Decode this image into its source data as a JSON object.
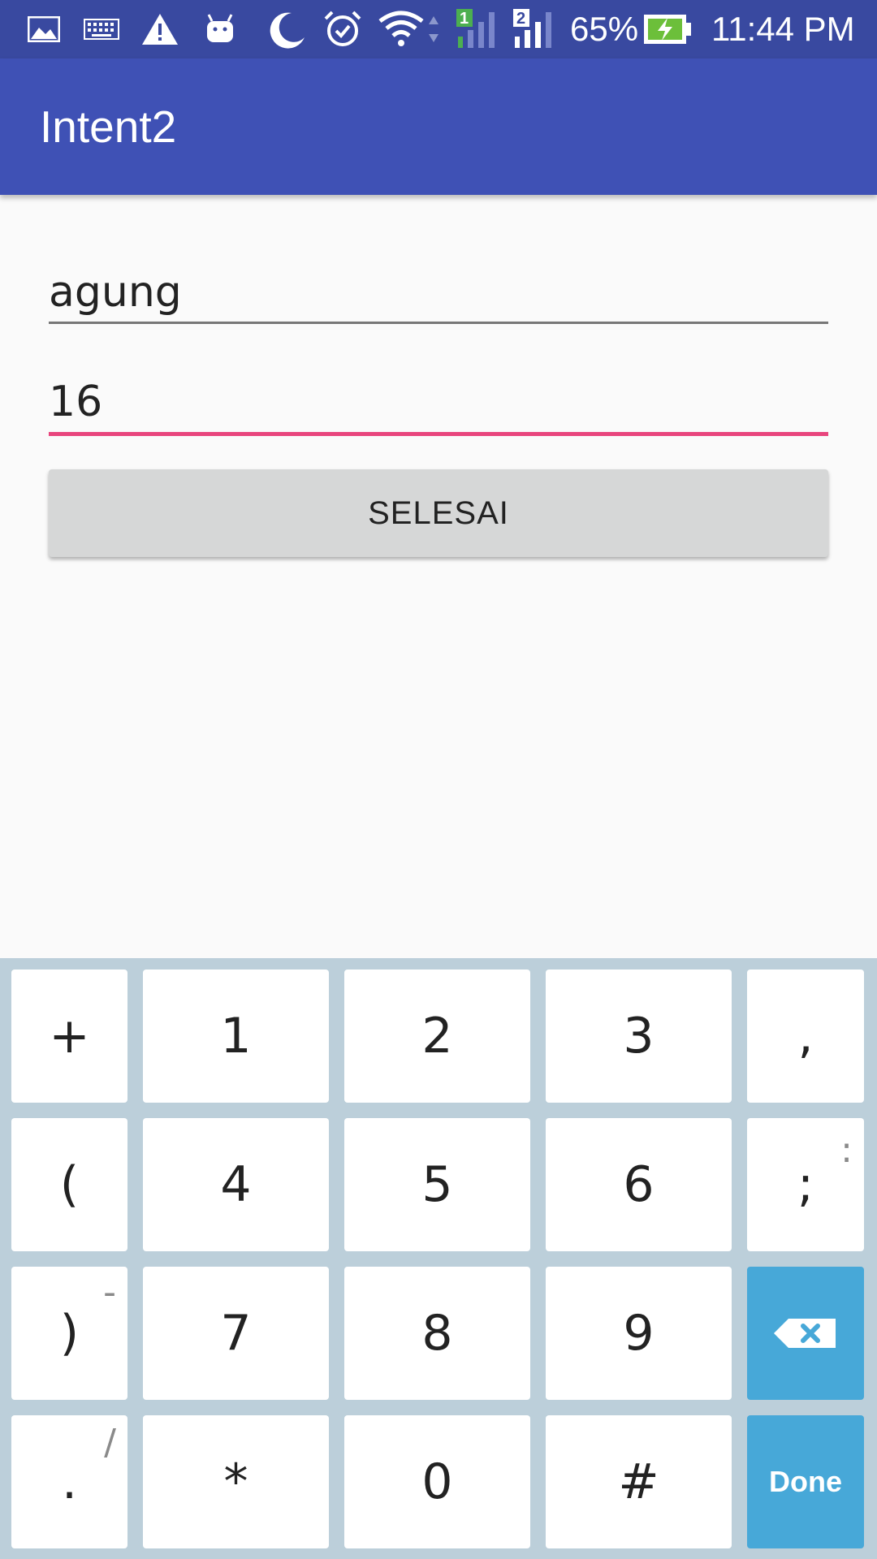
{
  "status_bar": {
    "icons": [
      "gallery-icon",
      "keyboard-icon",
      "warning-icon",
      "android-icon",
      "moon-icon",
      "alarm-icon",
      "wifi-icon",
      "signal-sim1-icon",
      "signal-sim2-icon",
      "battery-charging-icon"
    ],
    "sim1_label": "1",
    "sim2_label": "2",
    "battery_percent": "65%",
    "time": "11:44 PM"
  },
  "app_bar": {
    "title": "Intent2"
  },
  "form": {
    "name_value": "agung",
    "age_value": "16",
    "submit_label": "SELESAI"
  },
  "colors": {
    "status_bar": "#3949a0",
    "app_bar": "#3f51b5",
    "accent": "#e8457d",
    "keyboard_bg": "#bccfda",
    "key_blue": "#47a8d8"
  },
  "keyboard": {
    "rows": [
      [
        {
          "label": "+",
          "alt": ""
        },
        {
          "label": "1",
          "alt": ""
        },
        {
          "label": "2",
          "alt": ""
        },
        {
          "label": "3",
          "alt": ""
        },
        {
          "label": ",",
          "alt": ""
        }
      ],
      [
        {
          "label": "(",
          "alt": ""
        },
        {
          "label": "4",
          "alt": ""
        },
        {
          "label": "5",
          "alt": ""
        },
        {
          "label": "6",
          "alt": ""
        },
        {
          "label": ";",
          "alt": ":"
        }
      ],
      [
        {
          "label": ")",
          "alt": "-"
        },
        {
          "label": "7",
          "alt": ""
        },
        {
          "label": "8",
          "alt": ""
        },
        {
          "label": "9",
          "alt": ""
        },
        {
          "label": "",
          "alt": "",
          "icon": "backspace-icon"
        }
      ],
      [
        {
          "label": ".",
          "alt": "/"
        },
        {
          "label": "*",
          "alt": ""
        },
        {
          "label": "0",
          "alt": ""
        },
        {
          "label": "#",
          "alt": ""
        },
        {
          "label": "Done",
          "alt": ""
        }
      ]
    ]
  }
}
